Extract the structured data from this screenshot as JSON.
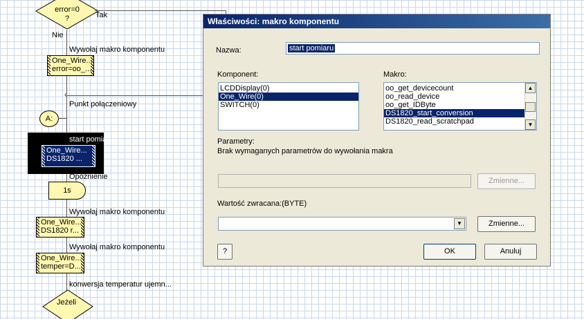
{
  "flowchart": {
    "decision_top": {
      "text": "error=0\n?",
      "yes": "Tak",
      "no": "Nie"
    },
    "call1": {
      "comment": "Wywołaj makro komponentu",
      "line1": "One_Wire...",
      "line2": "error=oo_..."
    },
    "connection_point": {
      "comment": "Punkt połączeniowy",
      "label": "A:"
    },
    "call_selected": {
      "comment": "start pomiaru",
      "line1": "One_Wire...",
      "line2": "DS1820 ..."
    },
    "delay": {
      "comment": "Opóźnienie",
      "label": "1s"
    },
    "call2": {
      "comment": "Wywołaj makro komponentu",
      "line1": "One_Wire...",
      "line2": "DS1820 r..."
    },
    "call3": {
      "comment": "Wywołaj makro komponentu",
      "line1": "One_Wire...",
      "line2": "temper=D..."
    },
    "comment_conversion": "konwersja temperatur ujemn...",
    "decision_bottom": {
      "text": "Jeżeli"
    }
  },
  "dialog": {
    "title": "Właściwości: makro komponentu",
    "name_label": "Nazwa:",
    "name_value": "start pomiaru",
    "component_label": "Komponent:",
    "components": [
      {
        "label": "LCDDisplay(0)",
        "selected": false
      },
      {
        "label": "One_Wire(0)",
        "selected": true
      },
      {
        "label": "SWITCH(0)",
        "selected": false
      }
    ],
    "macro_label": "Makro:",
    "macros": [
      {
        "label": "oo_get_devicecount",
        "selected": false
      },
      {
        "label": "oo_read_device",
        "selected": false
      },
      {
        "label": "oo_get_IDByte",
        "selected": false
      },
      {
        "label": "DS1820_start_conversion",
        "selected": true
      },
      {
        "label": "DS1820_read_scratchpad",
        "selected": false
      }
    ],
    "params_label": "Parametry:",
    "params_info": "Brak wymaganych parametrów do wywołania makra",
    "params_value": "",
    "variables_button_1": "Zmienne...",
    "return_label": "Wartość zwracana:(BYTE)",
    "return_value": "",
    "variables_button_2": "Zmienne...",
    "help_button": "?",
    "ok_button": "OK",
    "cancel_button": "Anuluj"
  },
  "colors": {
    "title_start": "#0a246a",
    "title_end": "#3a6ea5",
    "selection": "#0a246a",
    "macro_fill": "#fff8b0",
    "grid": "#c9d7ee"
  }
}
